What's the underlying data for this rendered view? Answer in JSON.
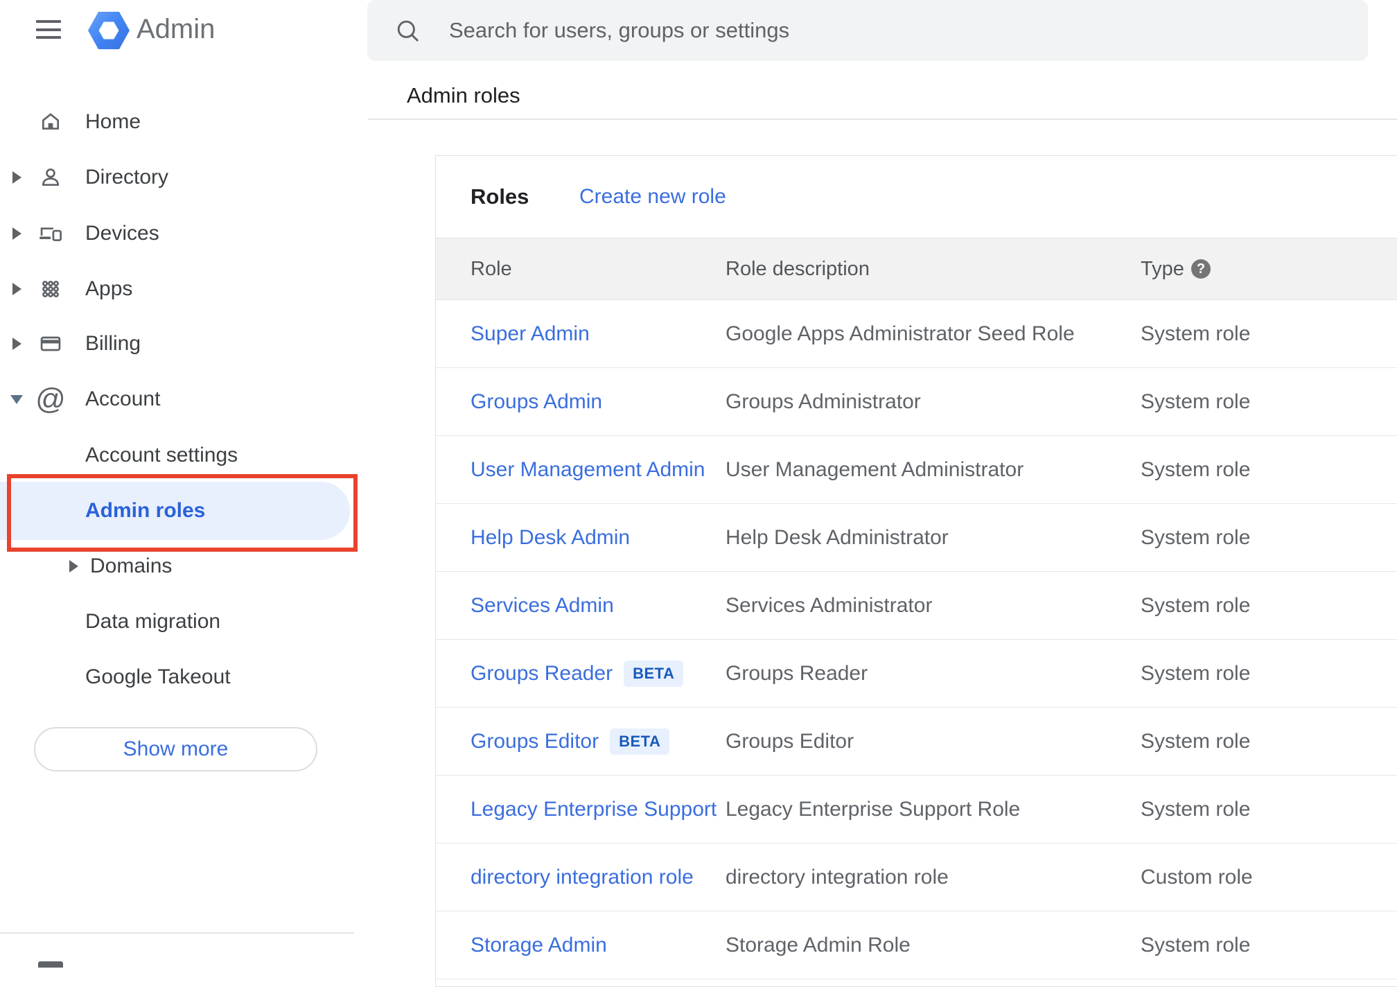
{
  "app": {
    "title": "Admin",
    "menu_icon": "hamburger",
    "logo_icon": "blue-hexagon-ring"
  },
  "search": {
    "placeholder": "Search for users, groups or settings",
    "icon": "magnifier"
  },
  "breadcrumb": "Admin roles",
  "sidebar": {
    "items": [
      {
        "label": "Home",
        "icon": "house",
        "expandable": false
      },
      {
        "label": "Directory",
        "icon": "person",
        "expandable": true
      },
      {
        "label": "Devices",
        "icon": "laptop-and-phone",
        "expandable": true
      },
      {
        "label": "Apps",
        "icon": "dot-grid",
        "expandable": true
      },
      {
        "label": "Billing",
        "icon": "credit-card",
        "expandable": true
      },
      {
        "label": "Account",
        "icon": "at-sign",
        "expandable": true,
        "expanded": true
      }
    ],
    "account_children": [
      {
        "label": "Account settings"
      },
      {
        "label": "Admin roles",
        "active": true,
        "annotated": true
      },
      {
        "label": "Domains",
        "expandable": true
      },
      {
        "label": "Data migration"
      },
      {
        "label": "Google Takeout"
      }
    ],
    "show_more_label": "Show more"
  },
  "roles_panel": {
    "title": "Roles",
    "create_link": "Create new role",
    "columns": {
      "role": "Role",
      "description": "Role description",
      "type": "Type",
      "help_glyph": "?",
      "help_icon": "question-mark-circle"
    },
    "rows": [
      {
        "role": "Super Admin",
        "description": "Google Apps Administrator Seed Role",
        "type": "System role"
      },
      {
        "role": "Groups Admin",
        "description": "Groups Administrator",
        "type": "System role"
      },
      {
        "role": "User Management Admin",
        "description": "User Management Administrator",
        "type": "System role"
      },
      {
        "role": "Help Desk Admin",
        "description": "Help Desk Administrator",
        "type": "System role"
      },
      {
        "role": "Services Admin",
        "description": "Services Administrator",
        "type": "System role"
      },
      {
        "role": "Groups Reader",
        "badge": "BETA",
        "description": "Groups Reader",
        "type": "System role"
      },
      {
        "role": "Groups Editor",
        "badge": "BETA",
        "description": "Groups Editor",
        "type": "System role"
      },
      {
        "role": "Legacy Enterprise Support",
        "description": "Legacy Enterprise Support Role",
        "type": "System role"
      },
      {
        "role": "directory integration role",
        "description": "directory integration role",
        "type": "Custom role"
      },
      {
        "role": "Storage Admin",
        "description": "Storage Admin Role",
        "type": "System role"
      }
    ]
  },
  "colors": {
    "link_blue": "#3a6edd",
    "active_item_text": "#2a62d9",
    "active_item_bg": "#e8f0fe",
    "annotation_red": "#e8432c",
    "beta_bg": "#e8f0fe",
    "beta_text": "#185abc",
    "table_header_bg": "#f2f2f2",
    "search_bg": "#f1f3f4",
    "logo_blue": "#4285f4",
    "icon_gray": "#5f6368"
  }
}
